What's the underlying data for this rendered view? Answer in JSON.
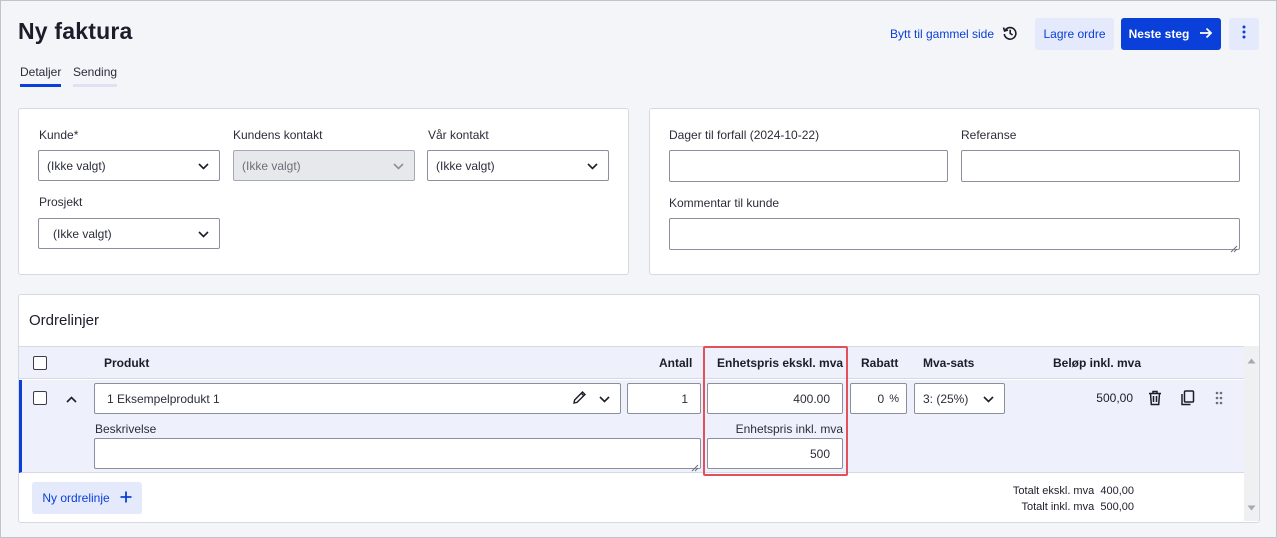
{
  "page": {
    "title": "Ny faktura",
    "tabs": [
      {
        "label": "Detaljer",
        "active": true
      },
      {
        "label": "Sending",
        "active": false
      }
    ]
  },
  "header": {
    "old_page_label": "Bytt til gammel side",
    "save_label": "Lagre ordre",
    "next_label": "Neste steg",
    "accent_color": "#0a3fd9"
  },
  "customer_card": {
    "customer": {
      "label": "Kunde*",
      "value": "(Ikke valgt)"
    },
    "customer_contact": {
      "label": "Kundens kontakt",
      "value": "(Ikke valgt)",
      "disabled": true
    },
    "our_contact": {
      "label": "Vår kontakt",
      "value": "(Ikke valgt)"
    },
    "project": {
      "label": "Prosjekt",
      "value": "(Ikke valgt)"
    }
  },
  "invoice_card": {
    "due_days": {
      "label": "Dager til forfall (2024-10-22)",
      "value": ""
    },
    "reference": {
      "label": "Referanse",
      "value": ""
    },
    "comment": {
      "label": "Kommentar til kunde",
      "value": ""
    }
  },
  "order_lines": {
    "title": "Ordrelinjer",
    "columns": {
      "product": "Produkt",
      "quantity": "Antall",
      "unit_price_excl": "Enhetspris ekskl. mva",
      "discount": "Rabatt",
      "vat_rate": "Mva-sats",
      "amount_incl": "Beløp inkl. mva"
    },
    "rows": [
      {
        "product": "1 Eksempelprodukt 1",
        "quantity": "1",
        "unit_price_excl": "400.00",
        "discount": "0",
        "discount_unit": "%",
        "vat_rate": "3: (25%)",
        "amount_incl": "500,00",
        "description_label": "Beskrivelse",
        "description": "",
        "unit_price_incl_label": "Enhetspris inkl. mva",
        "unit_price_incl": "500"
      }
    ],
    "new_line_label": "Ny ordrelinje",
    "totals": [
      {
        "label": "Totalt ekskl. mva",
        "value": "400,00"
      },
      {
        "label": "Totalt inkl. mva",
        "value": "500,00"
      }
    ],
    "highlight_color": "#e0515d"
  }
}
